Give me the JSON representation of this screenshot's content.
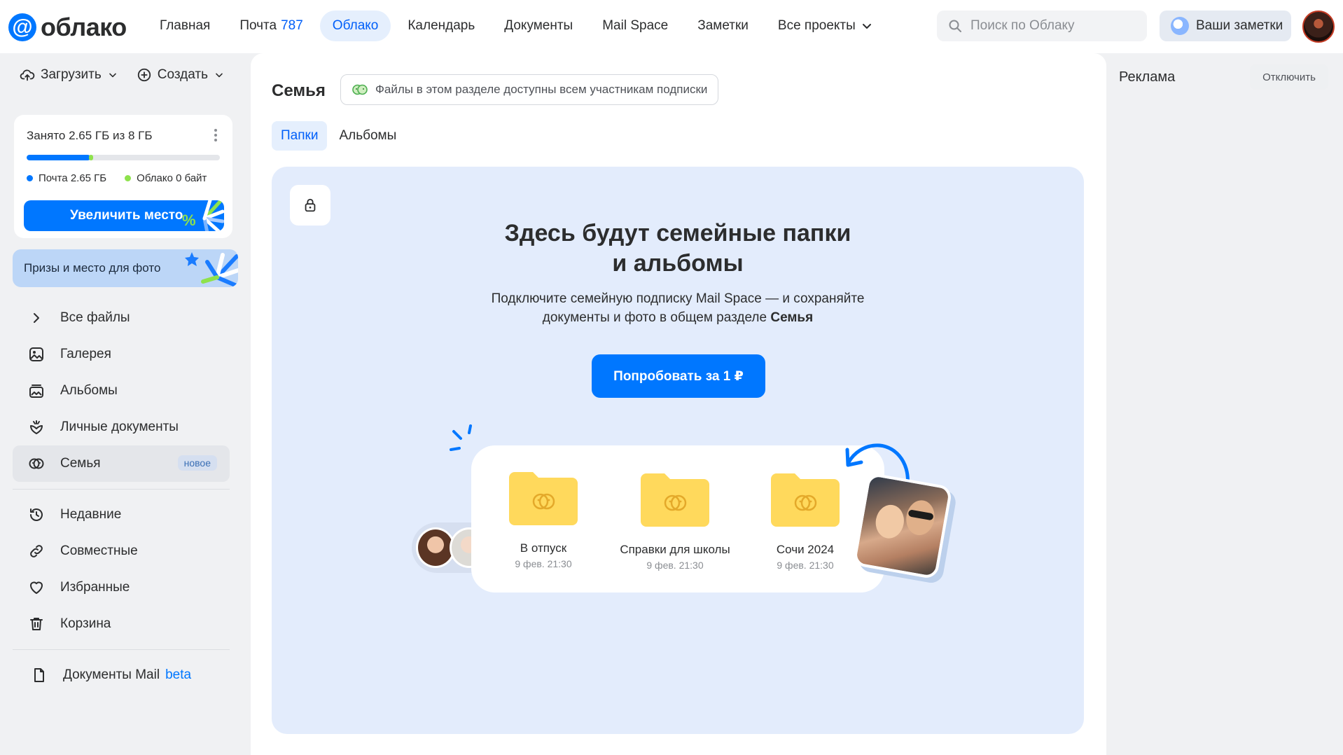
{
  "header": {
    "logo_symbol": "@",
    "logo_text": "облако",
    "nav": [
      {
        "label": "Главная"
      },
      {
        "label": "Почта",
        "count": "787"
      },
      {
        "label": "Облако",
        "active": true
      },
      {
        "label": "Календарь"
      },
      {
        "label": "Документы"
      },
      {
        "label": "Mail Space"
      },
      {
        "label": "Заметки"
      },
      {
        "label": "Все проекты"
      }
    ],
    "search_placeholder": "Поиск по Облаку",
    "notes_button": "Ваши заметки"
  },
  "sidebar": {
    "upload_label": "Загрузить",
    "create_label": "Создать",
    "storage": {
      "title": "Занято 2.65 ГБ из 8 ГБ",
      "used_fraction": 0.331,
      "mail_label": "Почта 2.65 ГБ",
      "cloud_label": "Облако 0 байт",
      "upgrade_button": "Увеличить место"
    },
    "promo": "Призы и место для фото",
    "items": [
      {
        "label": "Все файлы",
        "icon": "chevron-right-icon"
      },
      {
        "label": "Галерея",
        "icon": "gallery-icon"
      },
      {
        "label": "Альбомы",
        "icon": "albums-icon"
      },
      {
        "label": "Личные документы",
        "icon": "documents-icon"
      },
      {
        "label": "Семья",
        "icon": "family-icon",
        "badge": "новое",
        "active": true
      },
      {
        "label": "Недавние",
        "icon": "history-icon"
      },
      {
        "label": "Совместные",
        "icon": "link-icon"
      },
      {
        "label": "Избранные",
        "icon": "heart-icon"
      },
      {
        "label": "Корзина",
        "icon": "trash-icon"
      }
    ],
    "docs_mail": {
      "label": "Документы Mail",
      "badge": "beta"
    }
  },
  "main": {
    "title": "Семья",
    "info": "Файлы в этом разделе доступны всем участникам подписки",
    "tabs": [
      {
        "label": "Папки",
        "active": true
      },
      {
        "label": "Альбомы"
      }
    ],
    "empty": {
      "title_line1": "Здесь будут семейные папки",
      "title_line2": "и альбомы",
      "subtitle_line1": "Подключите семейную подписку Mail Space — и сохраняйте",
      "subtitle_line2_prefix": "документы и фото в общем разделе",
      "subtitle_line2_bold": "Семья",
      "button": "Попробовать за 1 ₽"
    },
    "folders": [
      {
        "name": "В отпуск",
        "date": "9 фев. 21:30"
      },
      {
        "name": "Справки для школы",
        "date": "9 фев. 21:30"
      },
      {
        "name": "Сочи 2024",
        "date": "9 фев. 21:30"
      }
    ]
  },
  "ads": {
    "label": "Реклама",
    "disable_button": "Отключить"
  },
  "colors": {
    "accent": "#0077ff",
    "active_nav_bg": "#e5effd",
    "empty_card_bg": "#e3ecfc",
    "folder_yellow": "#ffd95c",
    "cloud_green": "#8ee24c"
  }
}
